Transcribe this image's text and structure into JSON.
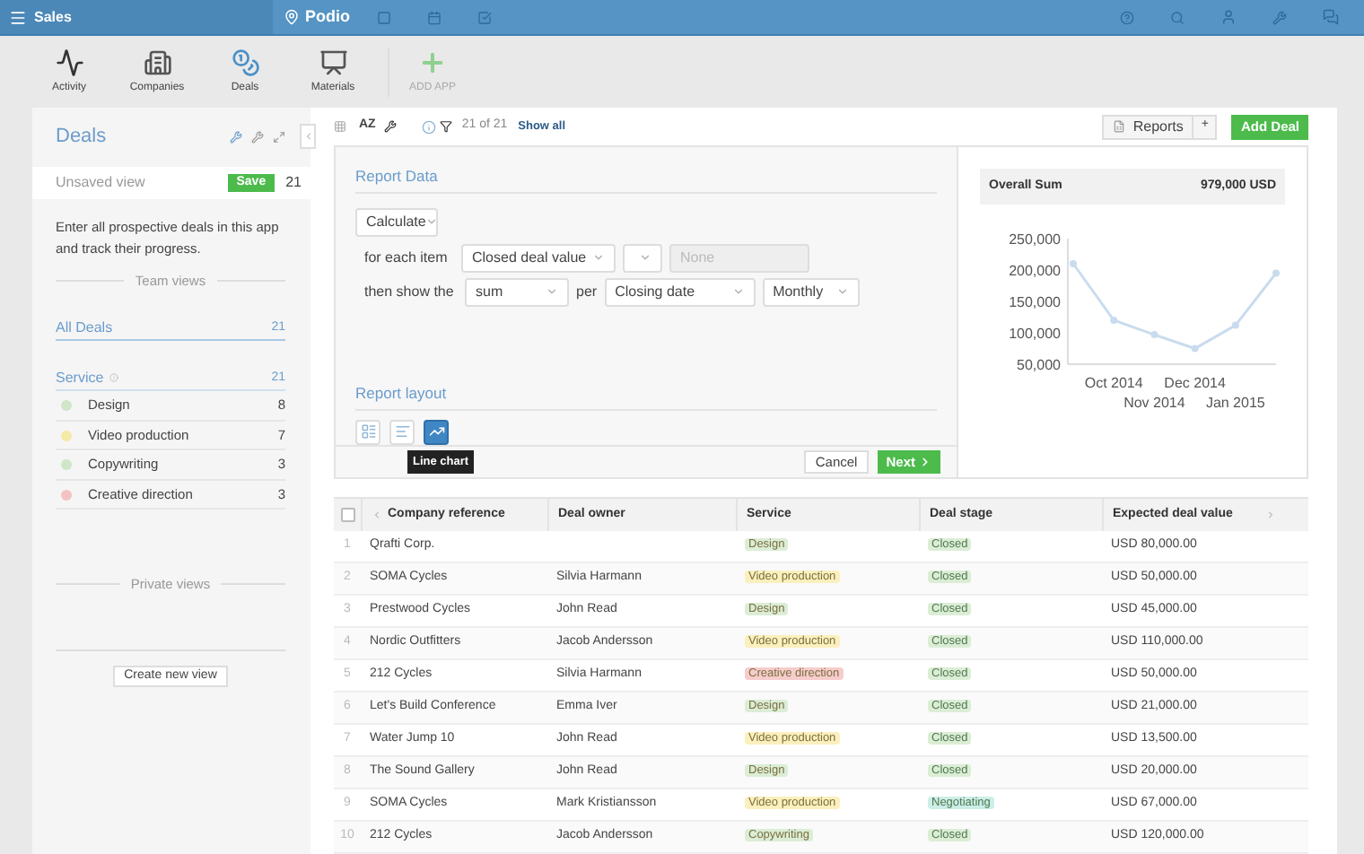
{
  "top_bar": {
    "workspace": "Sales",
    "logo": "Podio"
  },
  "apps": [
    {
      "label": "Activity",
      "kind": "activity",
      "disabled": false
    },
    {
      "label": "Companies",
      "kind": "companies",
      "disabled": false
    },
    {
      "label": "Deals",
      "kind": "deals",
      "disabled": false
    },
    {
      "label": "Materials",
      "kind": "materials",
      "disabled": false
    },
    {
      "label": "ADD APP",
      "kind": "add",
      "disabled": true
    }
  ],
  "sidebar": {
    "title": "Deals",
    "unsaved_view": {
      "label": "Unsaved view",
      "save": "Save",
      "count": "21"
    },
    "description": "Enter all prospective deals in this app and track their progress.",
    "team_views_heading": "Team views",
    "views": [
      {
        "label": "All Deals",
        "count": "21",
        "selected": true
      }
    ],
    "group": {
      "label": "Service",
      "count": "21",
      "items": [
        {
          "label": "Design",
          "count": "8",
          "color": "#cfe6c8"
        },
        {
          "label": "Video production",
          "count": "7",
          "color": "#f5e9a6"
        },
        {
          "label": "Copywriting",
          "count": "3",
          "color": "#cfe6c8"
        },
        {
          "label": "Creative direction",
          "count": "3",
          "color": "#f4c2c2"
        }
      ]
    },
    "private_views_heading": "Private views",
    "create_button": "Create new view"
  },
  "toolbar": {
    "sort": "AZ",
    "count": "21 of 21",
    "show_all": "Show all",
    "reports": "Reports",
    "plus": "+",
    "add_deal": "Add Deal"
  },
  "report": {
    "data_heading": "Report Data",
    "calculate": "Calculate",
    "for_each_label": "for each item",
    "field": "Closed deal value",
    "none": "None",
    "show_label": "then show the",
    "aggregate": "sum",
    "per_label": "per",
    "date_field": "Closing date",
    "interval": "Monthly",
    "layout_heading": "Report layout",
    "layouts": [
      {
        "kind": "table",
        "selected": false
      },
      {
        "kind": "bar",
        "selected": false
      },
      {
        "kind": "line",
        "selected": true
      }
    ],
    "tooltip": "Line chart",
    "cancel": "Cancel",
    "next": "Next",
    "summary_label": "Overall Sum",
    "summary_value": "979,000 USD",
    "chart_data": {
      "type": "line",
      "categories": [
        null,
        "Oct 2014",
        "Nov 2014",
        "Dec 2014",
        "Jan 2015",
        null
      ],
      "yticks": [
        {
          "value": 50000,
          "label": "50,000"
        },
        {
          "value": 100000,
          "label": "100,000"
        },
        {
          "value": 150000,
          "label": "150,000"
        },
        {
          "value": 200000,
          "label": "200,000"
        },
        {
          "value": 250000,
          "label": "250,000"
        }
      ],
      "ylim": [
        50000,
        250000
      ],
      "series": [
        {
          "color": "#c9dcee",
          "marker": "circle",
          "values": [
            210000,
            120000,
            97000,
            75000,
            112000,
            195000
          ]
        }
      ]
    }
  },
  "table": {
    "select_all_checked": false,
    "columns": [
      "Company reference",
      "Deal owner",
      "Service",
      "Deal stage",
      "Expected deal value"
    ],
    "rows": [
      {
        "number": "1",
        "company": "Qrafti Corp.",
        "owner": "",
        "service": {
          "label": "Design",
          "color": "#dcedd6"
        },
        "stage": {
          "label": "Closed",
          "color": "#dcedd6"
        },
        "value": "USD 80,000.00"
      },
      {
        "number": "2",
        "company": "SOMA Cycles",
        "owner": "Silvia Harmann",
        "service": {
          "label": "Video production",
          "color": "#fbf0bd"
        },
        "stage": {
          "label": "Closed",
          "color": "#dcedd6"
        },
        "value": "USD 50,000.00"
      },
      {
        "number": "3",
        "company": "Prestwood Cycles",
        "owner": "John Read",
        "service": {
          "label": "Design",
          "color": "#dcedd6"
        },
        "stage": {
          "label": "Closed",
          "color": "#dcedd6"
        },
        "value": "USD 45,000.00"
      },
      {
        "number": "4",
        "company": "Nordic Outfitters",
        "owner": "Jacob Andersson",
        "service": {
          "label": "Video production",
          "color": "#fbf0bd"
        },
        "stage": {
          "label": "Closed",
          "color": "#dcedd6"
        },
        "value": "USD 110,000.00"
      },
      {
        "number": "5",
        "company": "212 Cycles",
        "owner": "Silvia Harmann",
        "service": {
          "label": "Creative direction",
          "color": "#f7cccc"
        },
        "stage": {
          "label": "Closed",
          "color": "#dcedd6"
        },
        "value": "USD 50,000.00"
      },
      {
        "number": "6",
        "company": "Let's Build Conference",
        "owner": "Emma Iver",
        "service": {
          "label": "Design",
          "color": "#dcedd6"
        },
        "stage": {
          "label": "Closed",
          "color": "#dcedd6"
        },
        "value": "USD 21,000.00"
      },
      {
        "number": "7",
        "company": "Water Jump 10",
        "owner": "John Read",
        "service": {
          "label": "Video production",
          "color": "#fbf0bd"
        },
        "stage": {
          "label": "Closed",
          "color": "#dcedd6"
        },
        "value": "USD 13,500.00"
      },
      {
        "number": "8",
        "company": "The Sound Gallery",
        "owner": "John Read",
        "service": {
          "label": "Design",
          "color": "#dcedd6"
        },
        "stage": {
          "label": "Closed",
          "color": "#dcedd6"
        },
        "value": "USD 20,000.00"
      },
      {
        "number": "9",
        "company": "SOMA Cycles",
        "owner": "Mark Kristiansson",
        "service": {
          "label": "Video production",
          "color": "#fbf0bd"
        },
        "stage": {
          "label": "Negotiating",
          "color": "#cdeee8"
        },
        "value": "USD 67,000.00"
      },
      {
        "number": "10",
        "company": "212 Cycles",
        "owner": "Jacob Andersson",
        "service": {
          "label": "Copywriting",
          "color": "#dcedd6"
        },
        "stage": {
          "label": "Closed",
          "color": "#dcedd6"
        },
        "value": "USD 120,000.00"
      }
    ]
  }
}
